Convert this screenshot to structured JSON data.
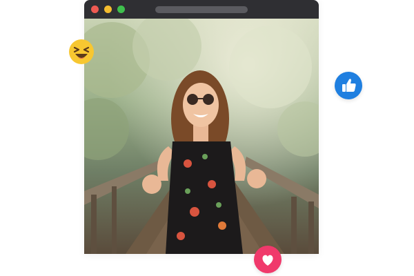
{
  "window": {
    "controls": [
      "close",
      "minimize",
      "maximize"
    ],
    "address_bar_value": ""
  },
  "photo": {
    "alt_icon": "photo-of-smiling-woman-peace-signs"
  },
  "reactions": [
    {
      "icon": "laughing-emoji-icon",
      "color": "#f7c731"
    },
    {
      "icon": "thumbs-up-icon",
      "color": "#1f7fe0"
    },
    {
      "icon": "heart-icon",
      "color": "#f0396b"
    }
  ],
  "colors": {
    "titlebar": "#2f2f33",
    "close": "#ef5a52",
    "minimize": "#f5bd2f",
    "maximize": "#3fc04d"
  }
}
